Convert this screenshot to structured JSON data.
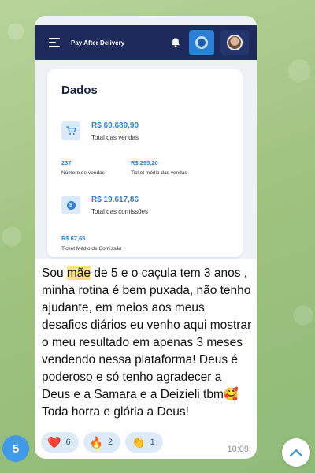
{
  "screenshot": {
    "app_title": "Pay After Delivery",
    "card_title": "Dados",
    "total_sales": {
      "value": "R$ 69.689,90",
      "label": "Total das vendas",
      "icon": "cart-icon"
    },
    "sales_count": {
      "value": "237",
      "label": "Número de vendas"
    },
    "avg_ticket": {
      "value": "R$ 295,20",
      "label": "Ticket médio das vendas"
    },
    "total_commission": {
      "value": "R$ 19.617,86",
      "label": "Total das comissões",
      "icon": "coin-icon"
    },
    "avg_commission": {
      "value": "R$ 67,65",
      "label": "Ticket Médio de Comissão"
    },
    "colors": {
      "appbar": "#1c2a5c",
      "accent": "#2f7fd8"
    }
  },
  "message": {
    "before_highlight": "Sou ",
    "highlight": "mãe",
    "after_highlight": " de 5 e o caçula tem 3 anos , minha rotina é  bem puxada, não tenho ajudante, em meios aos meus desafios diários eu venho aqui mostrar o meu resultado em apenas 3 meses vendendo nessa plataforma! Deus é poderoso e só tenho agradecer a Deus e a Samara e a Deizieli tbm🥰Toda horra e glória a Deus!",
    "time": "10:09"
  },
  "reactions": [
    {
      "emoji": "❤️",
      "count": "6"
    },
    {
      "emoji": "🔥",
      "count": "2"
    },
    {
      "emoji": "👏",
      "count": "1"
    }
  ],
  "unread_count": "5",
  "icons": {
    "scroll_down": "chevron-up-icon",
    "bell": "bell-icon",
    "menu": "menu-icon"
  }
}
